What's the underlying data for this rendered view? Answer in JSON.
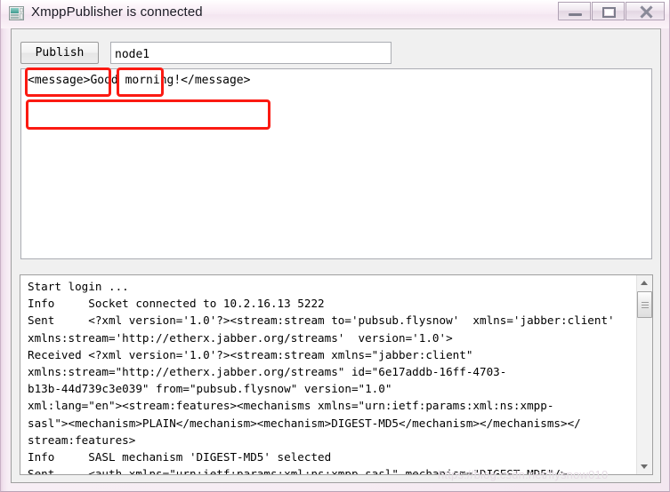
{
  "window": {
    "title": "XmppPublisher is connected",
    "icon": "application-window-icon",
    "controls": {
      "minimize": "minimize-button",
      "maximize": "restore-button",
      "close": "close-button"
    }
  },
  "toolbar": {
    "publish_label": "Publish",
    "node_value": "node1",
    "node_placeholder": ""
  },
  "message": {
    "value": "<message>Good morning!</message>",
    "placeholder": ""
  },
  "log": {
    "content": "Start login ...\nInfo     Socket connected to 10.2.16.13 5222\nSent     <?xml version='1.0'?><stream:stream to='pubsub.flysnow'  xmlns='jabber:client'\nxmlns:stream='http://etherx.jabber.org/streams'  version='1.0'>\nReceived <?xml version='1.0'?><stream:stream xmlns=\"jabber:client\"\nxmlns:stream=\"http://etherx.jabber.org/streams\" id=\"6e17addb-16ff-4703-\nb13b-44d739c3e039\" from=\"pubsub.flysnow\" version=\"1.0\"\nxml:lang=\"en\"><stream:features><mechanisms xmlns=\"urn:ietf:params:xml:ns:xmpp-\nsasl\"><mechanism>PLAIN</mechanism><mechanism>DIGEST-MD5</mechanism></mechanisms></\nstream:features>\nInfo     SASL mechanism 'DIGEST-MD5' selected\nSent     <auth xmlns=\"urn:ietf:params:xml:ns:xmpp-sasl\" mechanism=\"DIGEST-MD5\"/>\nReceived <challenge xmlns=\"urn:ietf:params:xml:ns:xmpp-",
    "scrollbar": {
      "up_arrow": "scroll-up-arrow",
      "down_arrow": "scroll-down-arrow"
    }
  },
  "annotations": {
    "publish": "publish-highlight",
    "node": "node-highlight",
    "message": "message-highlight"
  },
  "watermark": {
    "text": "https://blog.csdn.net/flysnow010"
  },
  "colors": {
    "annotation_red": "#fb1a12",
    "frame": "#f6ecf3",
    "client_background": "#f0f0f0"
  }
}
